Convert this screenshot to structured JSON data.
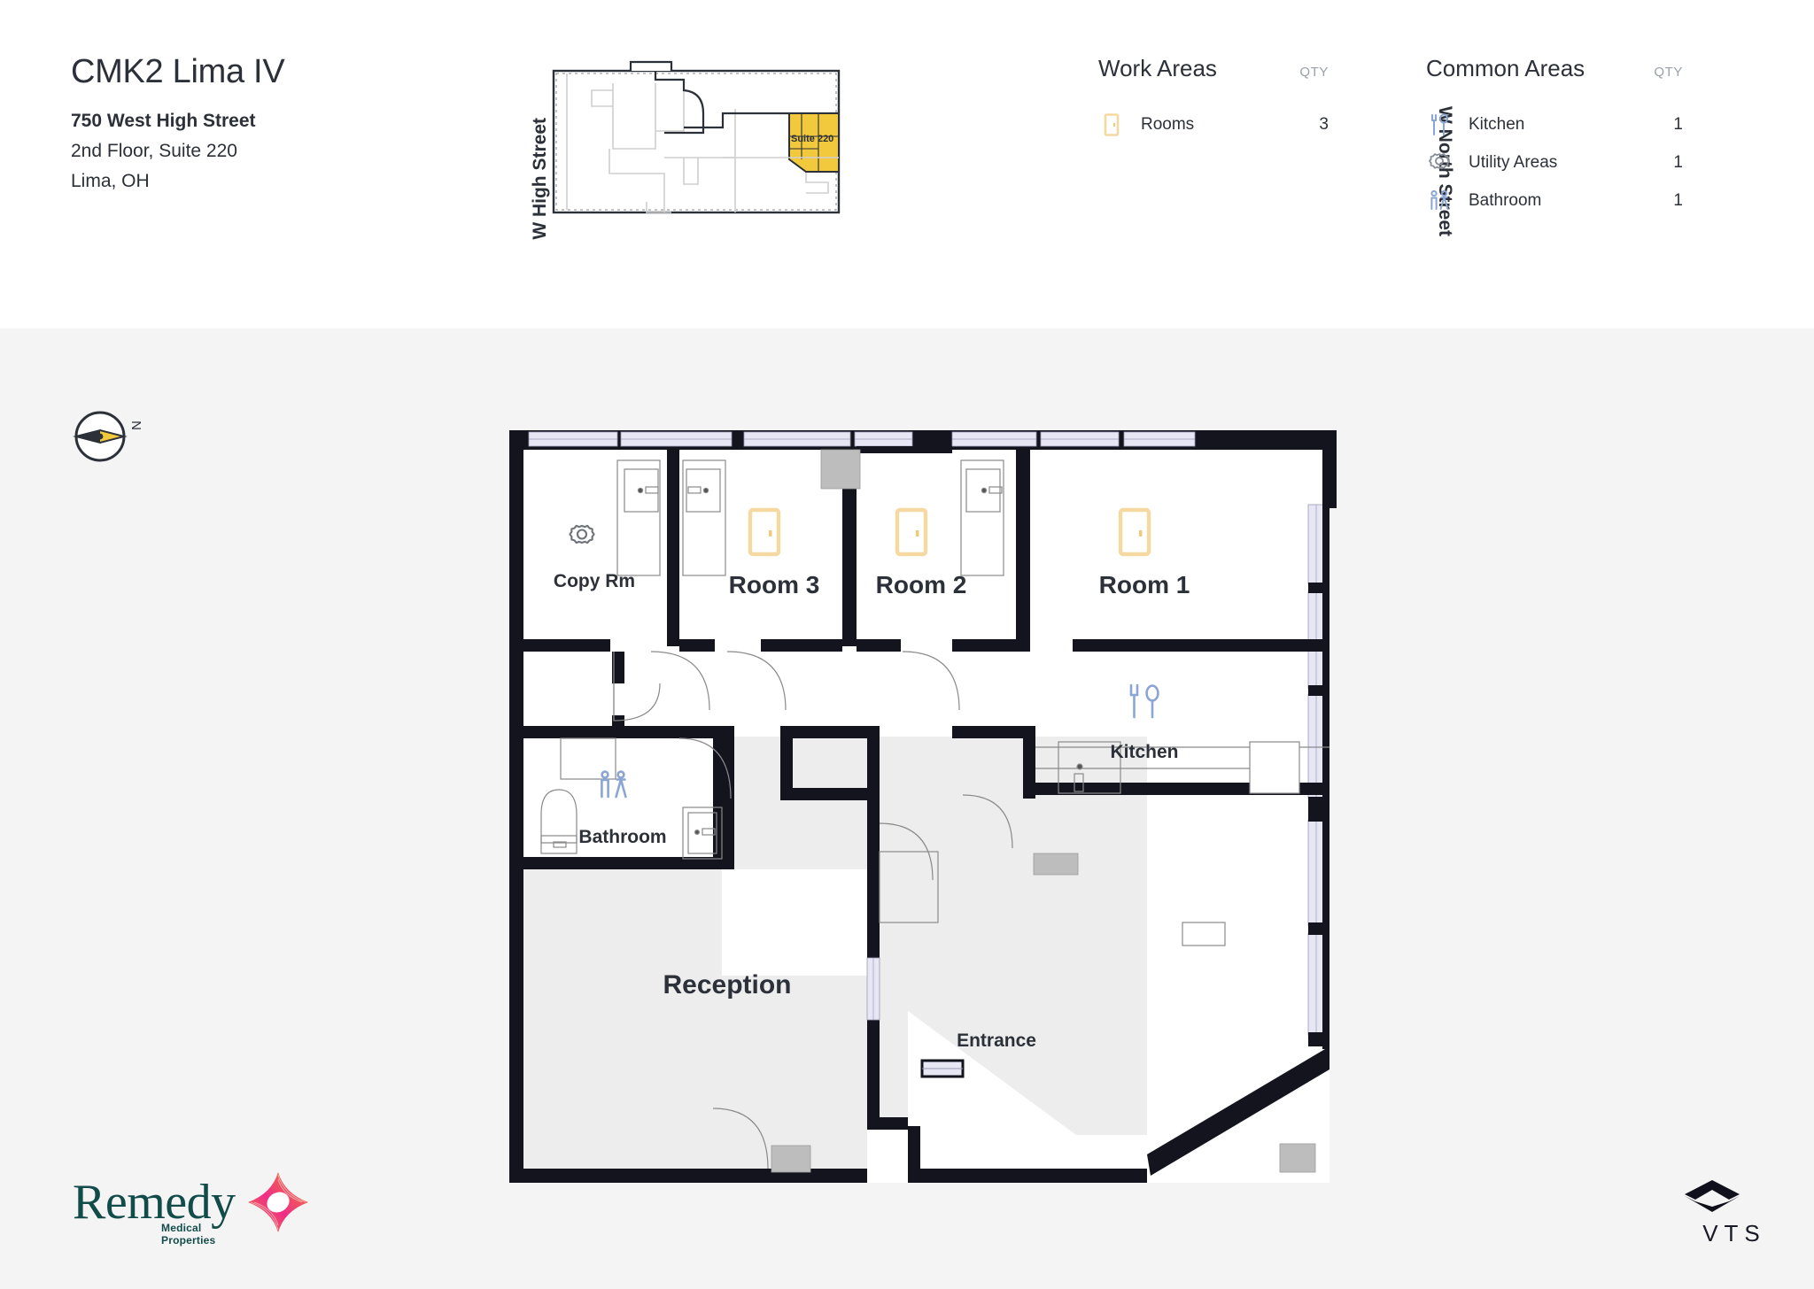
{
  "header": {
    "title": "CMK2 Lima IV",
    "address_line1": "750 West High Street",
    "address_line2": "2nd Floor, Suite 220",
    "address_line3": "Lima, OH"
  },
  "keymap": {
    "street_west": "W High Street",
    "street_north": "W North Street",
    "suite_label": "Suite 220",
    "highlight_color": "#f2c83c"
  },
  "legend": {
    "work_areas": {
      "title": "Work Areas",
      "qty_header": "QTY",
      "items": [
        {
          "icon": "door-icon",
          "label": "Rooms",
          "qty": "3",
          "color": "#f6d9a0"
        }
      ]
    },
    "common_areas": {
      "title": "Common Areas",
      "qty_header": "QTY",
      "items": [
        {
          "icon": "kitchen-utensils-icon",
          "label": "Kitchen",
          "qty": "1",
          "color": "#8ba6d4"
        },
        {
          "icon": "gear-icon",
          "label": "Utility Areas",
          "qty": "1",
          "color": "#8a9099"
        },
        {
          "icon": "restroom-people-icon",
          "label": "Bathroom",
          "qty": "1",
          "color": "#8ba6d4"
        }
      ]
    }
  },
  "compass": {
    "north_label": "N",
    "needle_dark": "#2c3038",
    "needle_accent": "#f2c83c"
  },
  "floorplan": {
    "rooms": [
      {
        "name": "Copy Rm",
        "icon": "gear-icon"
      },
      {
        "name": "Room 3",
        "icon": "door-icon"
      },
      {
        "name": "Room 2",
        "icon": "door-icon"
      },
      {
        "name": "Room 1",
        "icon": "door-icon"
      },
      {
        "name": "Kitchen",
        "icon": "kitchen-utensils-icon"
      },
      {
        "name": "Bathroom",
        "icon": "restroom-people-icon"
      },
      {
        "name": "Reception",
        "icon": null
      },
      {
        "name": "Entrance",
        "icon": null
      }
    ],
    "colors": {
      "wall": "#14141e",
      "window": "#e6e6f4",
      "column": "#bdbdbd",
      "reception_fill": "#ededed",
      "room_fill": "#ffffff",
      "fixture_line": "#8a8a8a",
      "door_amber": "#f6d9a0"
    }
  },
  "footer": {
    "remedy_name": "Remedy",
    "remedy_tagline": "Medical Properties",
    "vts_name": "VTS"
  }
}
